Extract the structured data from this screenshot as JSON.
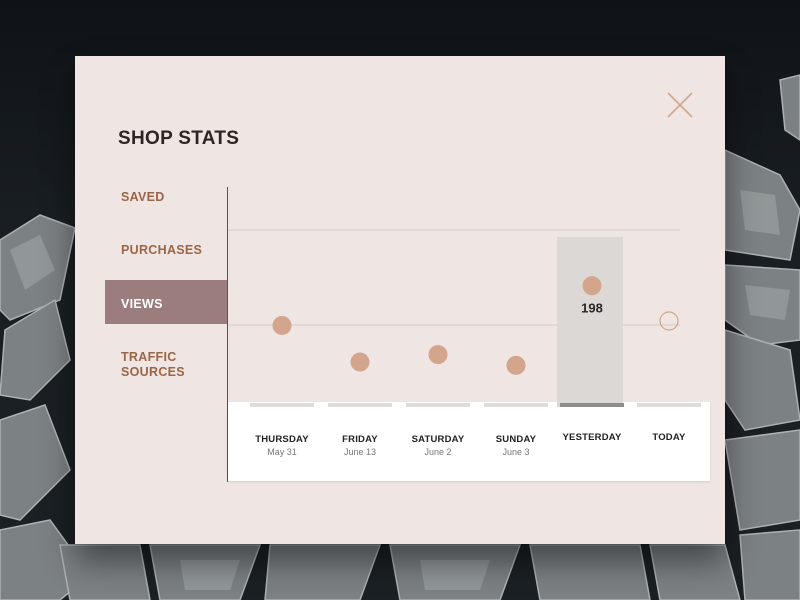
{
  "dialog": {
    "title": "SHOP STATS"
  },
  "menu": {
    "items": [
      {
        "label": "SAVED"
      },
      {
        "label": "PURCHASES"
      },
      {
        "label": "VIEWS",
        "active": true
      },
      {
        "label": "TRAFFIC SOURCES"
      }
    ]
  },
  "days": [
    {
      "name": "THURSDAY",
      "date": "May 31"
    },
    {
      "name": "FRIDAY",
      "date": "June 13"
    },
    {
      "name": "SATURDAY",
      "date": "June 2"
    },
    {
      "name": "SUNDAY",
      "date": "June 3"
    },
    {
      "name": "YESTERDAY",
      "date": ""
    },
    {
      "name": "TODAY",
      "date": ""
    }
  ],
  "highlight": {
    "value_label": "198"
  },
  "colors": {
    "card": "#efe5e2",
    "accent": "#9c6547",
    "active_menu": "#9a7d7c",
    "dot": "#d3a58d"
  },
  "icons": {
    "close": "close-icon"
  },
  "chart_data": {
    "type": "scatter",
    "categories": [
      "THURSDAY",
      "FRIDAY",
      "SATURDAY",
      "SUNDAY",
      "YESTERDAY",
      "TODAY"
    ],
    "series": [
      {
        "values": [
          150,
          106,
          115,
          102,
          198,
          null
        ]
      }
    ],
    "highlight_category": "YESTERDAY",
    "grid": true
  }
}
